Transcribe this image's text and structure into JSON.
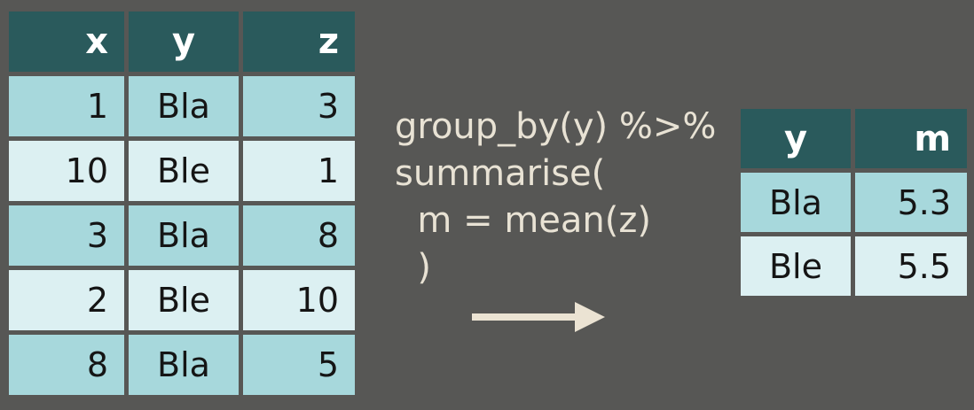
{
  "input_table": {
    "headers": [
      "x",
      "y",
      "z"
    ],
    "rows": [
      [
        "1",
        "Bla",
        "3"
      ],
      [
        "10",
        "Ble",
        "1"
      ],
      [
        "3",
        "Bla",
        "8"
      ],
      [
        "2",
        "Ble",
        "10"
      ],
      [
        "8",
        "Bla",
        "5"
      ]
    ]
  },
  "code": {
    "lines": [
      "group_by(y) %>%",
      "summarise(",
      "  m = mean(z)",
      "  )"
    ]
  },
  "output_table": {
    "headers": [
      "y",
      "m"
    ],
    "rows": [
      [
        "Bla",
        "5.3"
      ],
      [
        "Ble",
        "5.5"
      ]
    ]
  },
  "colors": {
    "background": "#575755",
    "header": "#2a5a5c",
    "row_dark": "#a7d8dc",
    "row_light": "#dcf0f2",
    "code_text": "#e8e2d4",
    "arrow": "#ebe3d3"
  },
  "icons": {
    "arrow": "arrow-right-icon"
  }
}
